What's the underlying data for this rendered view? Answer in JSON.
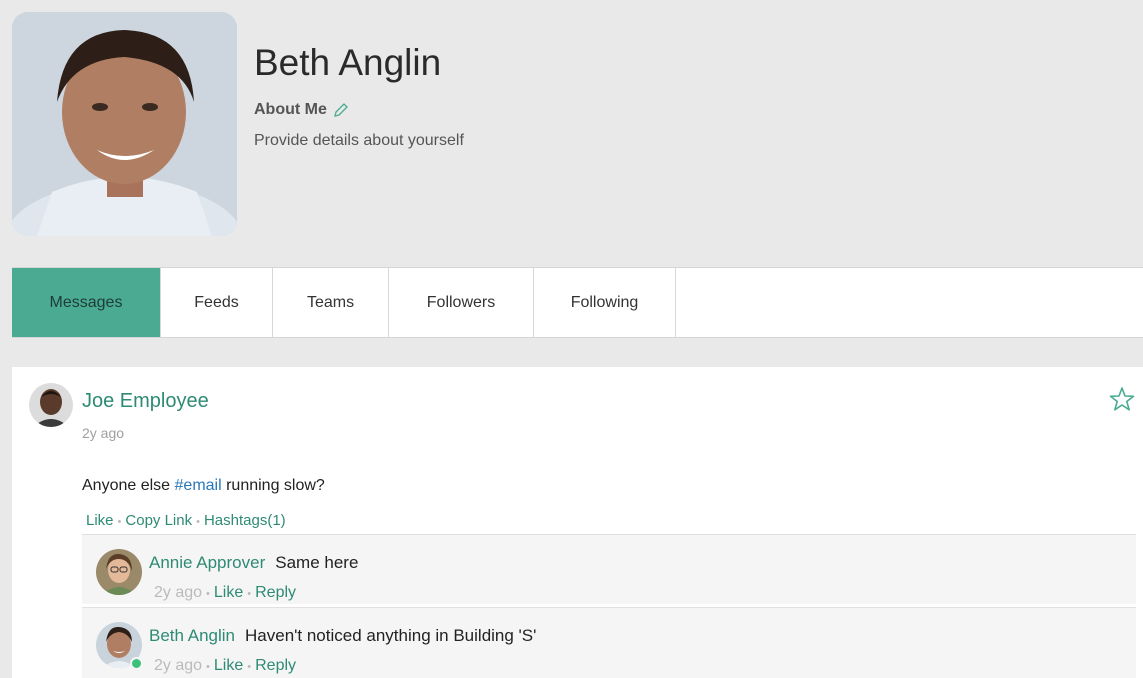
{
  "profile": {
    "name": "Beth Anglin",
    "about_label": "About Me",
    "about_desc": "Provide details about yourself"
  },
  "tabs": [
    {
      "label": "Messages",
      "active": true
    },
    {
      "label": "Feeds",
      "active": false
    },
    {
      "label": "Teams",
      "active": false
    },
    {
      "label": "Followers",
      "active": false
    },
    {
      "label": "Following",
      "active": false
    }
  ],
  "post": {
    "author": "Joe Employee",
    "time": "2y ago",
    "text_before": "Anyone else ",
    "hashtag": "#email",
    "text_after": " running slow?",
    "actions": {
      "like": "Like",
      "copy_link": "Copy Link",
      "hashtags": "Hashtags(1)"
    }
  },
  "comments": [
    {
      "author": "Annie Approver",
      "text": "Same here",
      "time": "2y ago",
      "like": "Like",
      "reply": "Reply"
    },
    {
      "author": "Beth Anglin",
      "text": "Haven't noticed anything in Building 'S'",
      "time": "2y ago",
      "like": "Like",
      "reply": "Reply"
    }
  ],
  "colors": {
    "accent": "#4aaa92",
    "link": "#2e8b73",
    "hashtag": "#2a77b8",
    "online": "#3cc17a"
  }
}
